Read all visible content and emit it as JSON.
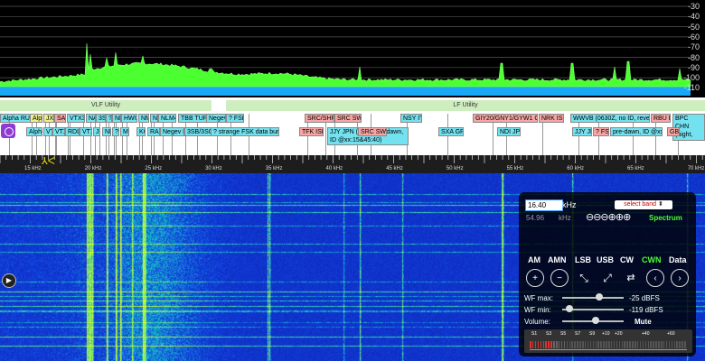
{
  "spectrum": {
    "db_labels": [
      "-30",
      "-40",
      "-50",
      "-60",
      "-70",
      "-80",
      "-90",
      "-100",
      "-110"
    ]
  },
  "bands": {
    "vlf": "VLF Utility",
    "lf": "LF Utility"
  },
  "labels": [
    {
      "t": "Alpha RUS",
      "c": "cy"
    },
    {
      "t": "Alph",
      "c": "yl"
    },
    {
      "t": "JXN",
      "c": "yl"
    },
    {
      "t": "SAQ",
      "c": "pk"
    },
    {
      "t": "VTX3",
      "c": "cy"
    },
    {
      "t": "NAA",
      "c": "cy"
    },
    {
      "t": "3SB",
      "c": "cy"
    },
    {
      "t": "?",
      "c": "cy"
    },
    {
      "t": "NPM",
      "c": "cy"
    },
    {
      "t": "HWU",
      "c": "cy"
    },
    {
      "t": "NML",
      "c": "cy"
    },
    {
      "t": "NLK",
      "c": "cy"
    },
    {
      "t": "NLM4",
      "c": "cy"
    },
    {
      "t": "TBB TUR",
      "c": "cy"
    },
    {
      "t": "Negev",
      "c": "cy"
    },
    {
      "t": "? FSK",
      "c": "cy"
    },
    {
      "t": "SRC/SHR",
      "c": "pk"
    },
    {
      "t": "SRC SWE",
      "c": "pk"
    },
    {
      "t": "NSY ITA",
      "c": "cy"
    },
    {
      "t": "GIY20/GNY1/GYW1 GBR",
      "c": "pk"
    },
    {
      "t": "NRK ISL",
      "c": "pk"
    },
    {
      "t": "WWVB (0630Z, no ID, reverse)",
      "c": "cy"
    },
    {
      "t": "RBU RUS",
      "c": "pk"
    },
    {
      "t": "BPC CHN (night, pre-dawn)",
      "c": "cy"
    },
    {
      "t": "Alpha",
      "c": "cy"
    },
    {
      "t": "VT",
      "c": "cy"
    },
    {
      "t": "VTX",
      "c": "cy"
    },
    {
      "t": "RDL",
      "c": "cy"
    },
    {
      "t": "VTX",
      "c": "cy"
    },
    {
      "t": "JC",
      "c": "cy"
    },
    {
      "t": "NP",
      "c": "cy"
    },
    {
      "t": "?",
      "c": "cy"
    },
    {
      "t": "MH",
      "c": "cy"
    },
    {
      "t": "KC",
      "c": "cy"
    },
    {
      "t": "RAB",
      "c": "cy"
    },
    {
      "t": "Negev I",
      "c": "cy"
    },
    {
      "t": "3SB/3SQ",
      "c": "cy"
    },
    {
      "t": "? strange FSK data bursts",
      "c": "cy"
    },
    {
      "t": "TFK ISL",
      "c": "pk"
    },
    {
      "t": "JJY JPN (night, pre-dawn, ID @xx:15&45:40)",
      "c": "cy"
    },
    {
      "t": "SRC SWE",
      "c": "pk"
    },
    {
      "t": "SXA GRC",
      "c": "cy"
    },
    {
      "t": "NDI JPN",
      "c": "cy"
    },
    {
      "t": "JJY JPN",
      "c": "cy"
    },
    {
      "t": "? FSK",
      "c": "pk"
    },
    {
      "t": "pre-dawn, ID @xx:1",
      "c": "cy"
    },
    {
      "t": "GBR",
      "c": "pk"
    }
  ],
  "scale": {
    "labels": [
      "15 kHz",
      "20 kHz",
      "25 kHz",
      "30 kHz",
      "35 kHz",
      "40 kHz",
      "45 kHz",
      "50 kHz",
      "55 kHz",
      "60 kHz",
      "65 kHz",
      "70 kHz"
    ]
  },
  "panel": {
    "freq": "16.40",
    "freq_unit": "kHz",
    "select_band": "select band",
    "freq2": "54.96",
    "freq2_unit": "kHz",
    "zoom_symbols": "⊖⊖⊖⊕⊕⊕",
    "spectrum_label": "Spectrum",
    "modes": [
      "AM",
      "AMN",
      "LSB",
      "USB",
      "CW",
      "CWN",
      "Data"
    ],
    "wf_max_label": "WF max:",
    "wf_max_value": "-25 dBFS",
    "wf_min_label": "WF min:",
    "wf_min_value": "-119 dBFS",
    "volume_label": "Volume:",
    "mute_label": "Mute",
    "smeter_labels": [
      "S1",
      "S3",
      "S5",
      "S7",
      "S9",
      "+10",
      "+20",
      "+40",
      "+60"
    ],
    "wf_max_level": 0.3,
    "wf_min_level": 0.0,
    "volume_level": 0.4
  },
  "colors": {
    "accent": "#8d3bd1",
    "wf_blue": "#1c2fc9",
    "spectrum_green": "#4cff30",
    "spectrum_cyan": "#19a8f5"
  }
}
